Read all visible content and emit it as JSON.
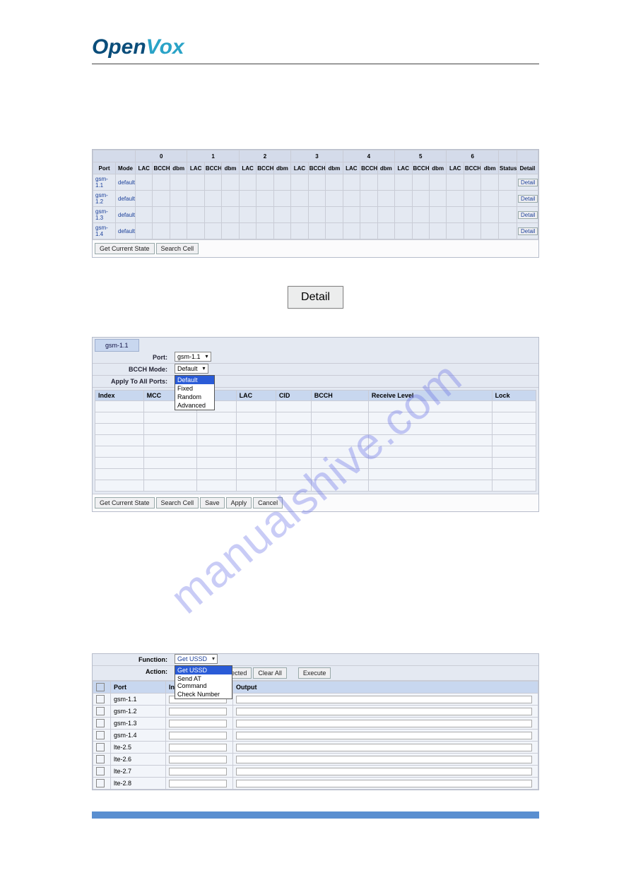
{
  "logo": {
    "open": "Open",
    "vox": "Vox"
  },
  "watermark": "manualshive.com",
  "table1": {
    "group_headers": [
      "0",
      "1",
      "2",
      "3",
      "4",
      "5",
      "6"
    ],
    "headers": [
      "Port",
      "Mode",
      "LAC",
      "BCCH",
      "dbm",
      "LAC",
      "BCCH",
      "dbm",
      "LAC",
      "BCCH",
      "dbm",
      "LAC",
      "BCCH",
      "dbm",
      "LAC",
      "BCCH",
      "dbm",
      "LAC",
      "BCCH",
      "dbm",
      "LAC",
      "BCCH",
      "dbm",
      "Status",
      "Detail"
    ],
    "rows": [
      {
        "port": "gsm-1.1",
        "mode": "default",
        "detail": "Detail"
      },
      {
        "port": "gsm-1.2",
        "mode": "default",
        "detail": "Detail"
      },
      {
        "port": "gsm-1.3",
        "mode": "default",
        "detail": "Detail"
      },
      {
        "port": "gsm-1.4",
        "mode": "default",
        "detail": "Detail"
      }
    ],
    "buttons": [
      "Get Current State",
      "Search Cell"
    ]
  },
  "detail_button_label": "Detail",
  "panel2": {
    "tab": "gsm-1.1",
    "port_label": "Port:",
    "port_value": "gsm-1.1",
    "bcch_label": "BCCH Mode:",
    "bcch_value": "Default",
    "bcch_options": [
      "Default",
      "Fixed",
      "Random",
      "Advanced"
    ],
    "apply_label": "Apply To All Ports:",
    "columns": [
      "Index",
      "MCC",
      "MNC",
      "LAC",
      "CID",
      "BCCH",
      "Receive Level",
      "Lock"
    ],
    "buttons": [
      "Get Current State",
      "Search Cell",
      "Save",
      "Apply",
      "Cancel"
    ]
  },
  "panel3": {
    "function_label": "Function:",
    "function_value": "Get USSD",
    "function_options": [
      "Get USSD",
      "Send AT Command",
      "Check Number"
    ],
    "action_label": "Action:",
    "action_buttons": [
      "Copy to Selected",
      "Clear All",
      "Execute"
    ],
    "columns": [
      "",
      "Port",
      "Input",
      "Output"
    ],
    "rows": [
      "gsm-1.1",
      "gsm-1.2",
      "gsm-1.3",
      "gsm-1.4",
      "lte-2.5",
      "lte-2.6",
      "lte-2.7",
      "lte-2.8"
    ]
  }
}
